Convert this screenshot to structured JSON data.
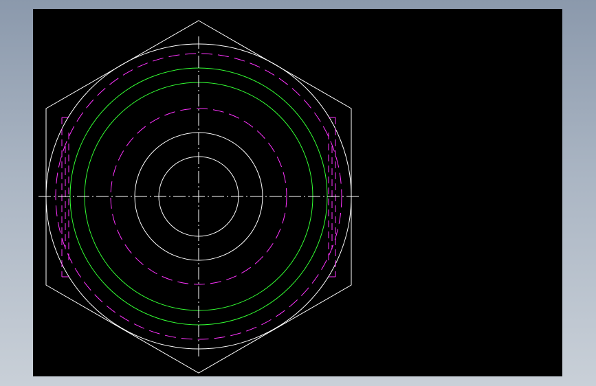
{
  "drawing": {
    "background": "#000000",
    "colors": {
      "outline": "#ffffff",
      "hidden": "#ff33ff",
      "thread": "#33ff33",
      "centerline": "#ffffff"
    }
  }
}
